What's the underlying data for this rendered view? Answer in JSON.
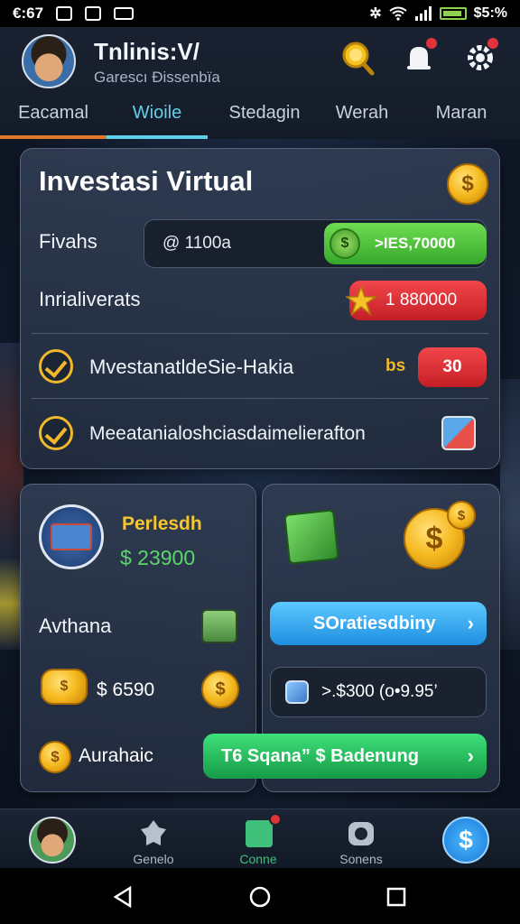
{
  "status_bar": {
    "time": "€:67",
    "battery": "$5:%"
  },
  "header": {
    "title": "Tnlinis:V/",
    "subtitle": "Garescı Ðissenbïa"
  },
  "tabs": [
    {
      "label": "Eacamal",
      "active": false
    },
    {
      "label": "Wioile",
      "active": true
    },
    {
      "label": "Stedagin",
      "active": false
    },
    {
      "label": "Werah",
      "active": false
    },
    {
      "label": "Maran",
      "active": false
    }
  ],
  "investasi": {
    "title": "Investasi Virtual",
    "fivahs_label": "Fivahs",
    "fivahs_value": "@ 1100a",
    "fivahs_badge": ">‡đ.S, 0",
    "fivahs_badge_text": ">IES,70000",
    "initial_label": "Inrialiverats",
    "initial_value": "1 880000",
    "row3_text": "MvestanatldeSie-Hakia",
    "row3_tag": "bs",
    "row3_value": "30",
    "row4_text": "Meeatanialoshciasdaimelierafton"
  },
  "left_card": {
    "title": "Perlesdh",
    "amount": "$ 23900",
    "avthana_label": "Avthana",
    "coins_value": "$ 6590",
    "aurahaic_label": "Aurahaic"
  },
  "right_card": {
    "primary_button": "SOratiesdbiny",
    "info_text": ">.$300 (o•9.95’",
    "green_button": "T6 Sqana” $ Badenung"
  },
  "bottom_nav": [
    {
      "label": "",
      "icon": "profile-avatar"
    },
    {
      "label": "Genelo",
      "icon": "leaf-icon"
    },
    {
      "label": "Conne",
      "icon": "book-icon",
      "active": true
    },
    {
      "label": "Sonens",
      "icon": "camera-icon"
    },
    {
      "label": "",
      "icon": "dollar-icon"
    }
  ],
  "colors": {
    "accent_cyan": "#5fd0ea",
    "green": "#3fc07a",
    "red": "#e0343a",
    "gold": "#f0b82a",
    "blue": "#2a9fe8"
  }
}
